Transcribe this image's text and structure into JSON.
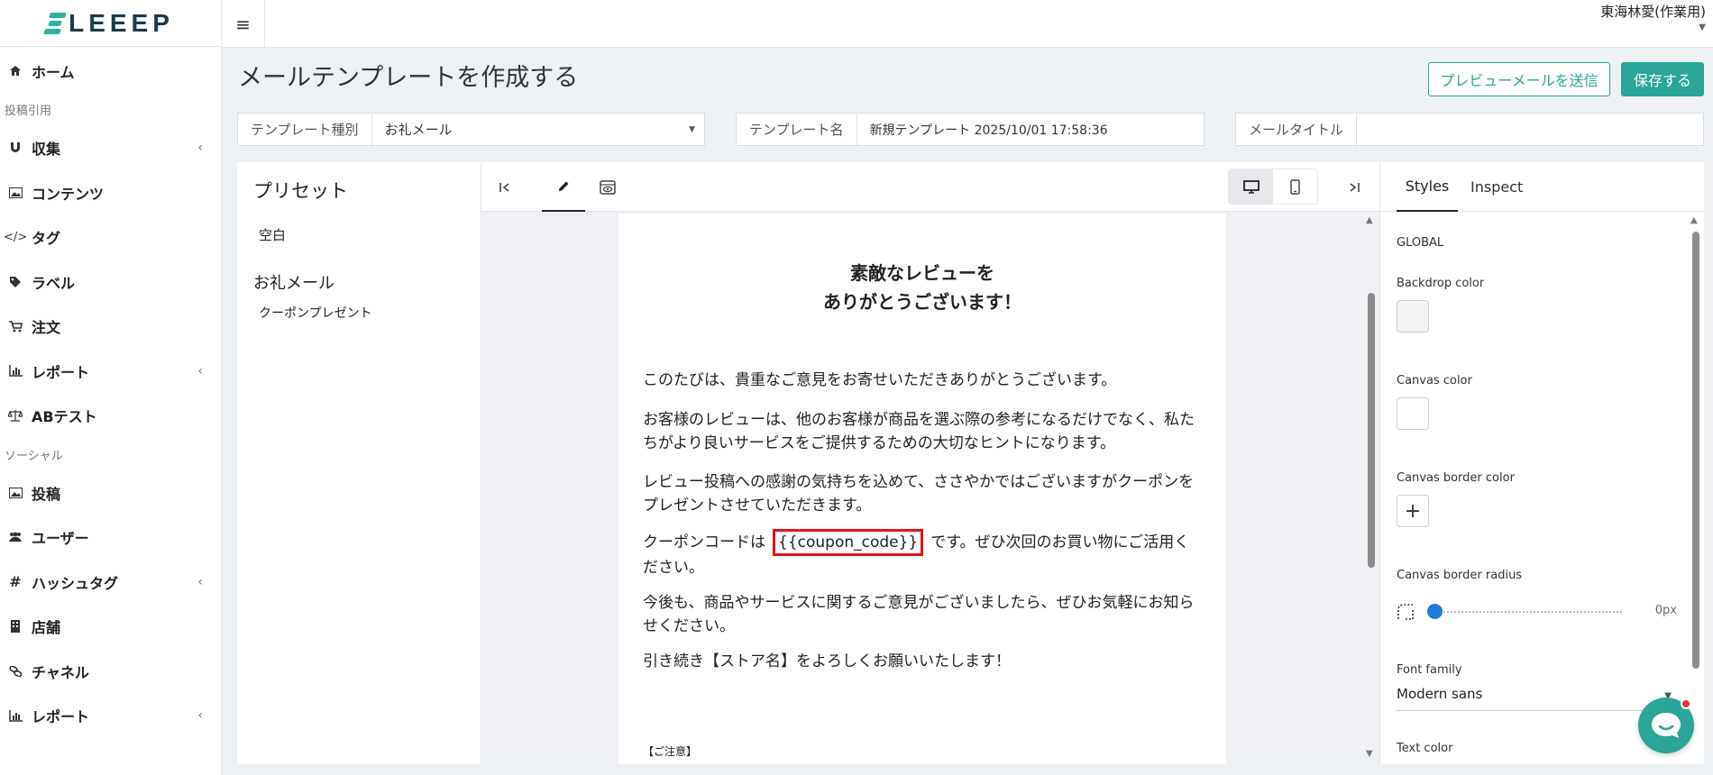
{
  "app": {
    "logo_text": "LEEEP",
    "user_name": "東海林愛(作業用)"
  },
  "sidebar": {
    "items": [
      {
        "label": "ホーム",
        "icon": "home-icon"
      },
      {
        "section": "投稿引用"
      },
      {
        "label": "収集",
        "icon": "magnet-icon",
        "expandable": true
      },
      {
        "label": "コンテンツ",
        "icon": "image-icon"
      },
      {
        "label": "タグ",
        "icon": "code-icon"
      },
      {
        "label": "ラベル",
        "icon": "tag-icon"
      },
      {
        "label": "注文",
        "icon": "cart-icon"
      },
      {
        "label": "レポート",
        "icon": "bar-chart-icon",
        "expandable": true
      },
      {
        "label": "ABテスト",
        "icon": "scale-icon"
      },
      {
        "section": "ソーシャル"
      },
      {
        "label": "投稿",
        "icon": "image-icon"
      },
      {
        "label": "ユーザー",
        "icon": "users-icon"
      },
      {
        "label": "ハッシュタグ",
        "icon": "hashtag-icon",
        "expandable": true
      },
      {
        "label": "店舗",
        "icon": "building-icon"
      },
      {
        "label": "チャネル",
        "icon": "link-icon"
      },
      {
        "label": "レポート",
        "icon": "bar-chart-icon",
        "expandable": true
      }
    ]
  },
  "page": {
    "title": "メールテンプレートを作成する",
    "preview_button": "プレビューメールを送信",
    "save_button": "保存する",
    "fields": {
      "template_type_label": "テンプレート種別",
      "template_type_value": "お礼メール",
      "template_name_label": "テンプレート名",
      "template_name_value": "新規テンプレート 2025/10/01 17:58:36",
      "mail_title_label": "メールタイトル",
      "mail_title_value": ""
    }
  },
  "presets": {
    "heading": "プリセット",
    "blank": "空白",
    "group": "お礼メール",
    "coupon": "クーポンプレゼント"
  },
  "email": {
    "title_line1": "素敵なレビューを",
    "title_line2": "ありがとうございます！",
    "p1": "このたびは、貴重なご意見をお寄せいただきありがとうございます。",
    "p2": "お客様のレビューは、他のお客様が商品を選ぶ際の参考になるだけでなく、私たちがより良いサービスをご提供するための大切なヒントになります。",
    "p3": "レビュー投稿への感謝の気持ちを込めて、ささやかではございますがクーポンをプレゼントさせていただきます。",
    "p4_before": "クーポンコードは",
    "coupon_code": "{{coupon_code}}",
    "p4_after": "です。ぜひ次回のお買い物にご活用ください。",
    "p5": "今後も、商品やサービスに関するご意見がございましたら、ぜひお気軽にお知らせください。",
    "p6": "引き続き【ストア名】をよろしくお願いいたします！",
    "notice": "【ご注意】"
  },
  "styles_panel": {
    "tab_styles": "Styles",
    "tab_inspect": "Inspect",
    "global": "GLOBAL",
    "backdrop_color_label": "Backdrop color",
    "backdrop_color": "#f2f3f5",
    "canvas_color_label": "Canvas color",
    "canvas_color": "#ffffff",
    "canvas_border_color_label": "Canvas border color",
    "canvas_border_radius_label": "Canvas border radius",
    "canvas_border_radius_value": "0px",
    "font_family_label": "Font family",
    "font_family_value": "Modern sans",
    "text_color_label": "Text color"
  },
  "colors": {
    "accent": "#2aa596",
    "highlight": "#e0141c",
    "slider": "#1f7bd6"
  }
}
